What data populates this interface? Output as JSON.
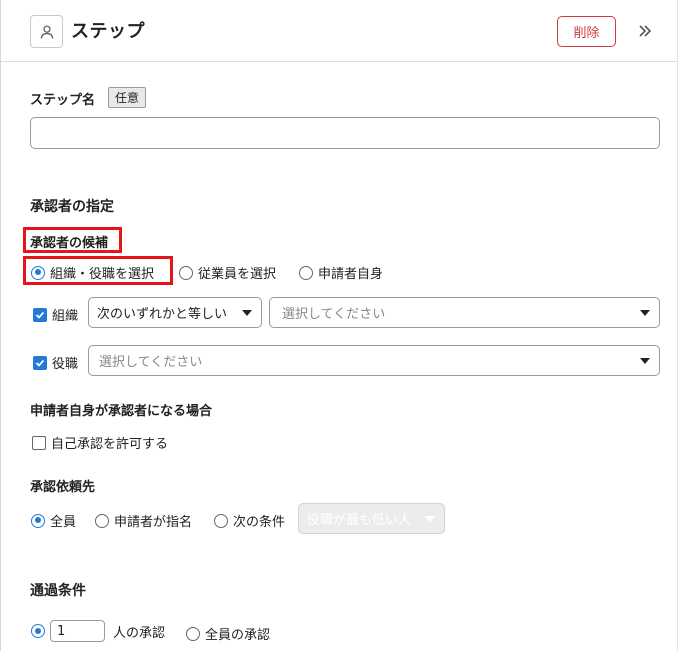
{
  "header": {
    "title": "ステップ",
    "delete_label": "削除",
    "icon": "user-icon",
    "collapse_icon": "double-chevron-right-icon"
  },
  "step_name": {
    "label": "ステップ名",
    "badge": "任意",
    "value": ""
  },
  "approver": {
    "section_title": "承認者の指定",
    "candidates_label": "承認者の候補",
    "candidate_options": [
      {
        "label": "組織・役職を選択",
        "selected": true
      },
      {
        "label": "従業員を選択",
        "selected": false
      },
      {
        "label": "申請者自身",
        "selected": false
      }
    ],
    "org": {
      "label": "組織",
      "checked": true,
      "operator": "次のいずれかと等しい",
      "placeholder": "選択してください"
    },
    "position": {
      "label": "役職",
      "checked": true,
      "placeholder": "選択してください"
    }
  },
  "self_approval": {
    "title": "申請者自身が承認者になる場合",
    "checkbox_label": "自己承認を許可する",
    "checked": false
  },
  "request_target": {
    "title": "承認依頼先",
    "options": [
      {
        "label": "全員",
        "selected": true
      },
      {
        "label": "申請者が指名",
        "selected": false
      },
      {
        "label": "次の条件",
        "selected": false
      }
    ],
    "condition_select": "役職が最も低い人"
  },
  "pass_condition": {
    "title": "通過条件",
    "count_value": "1",
    "count_suffix": "人の承認",
    "all_label": "全員の承認"
  },
  "colors": {
    "accent": "#1f7bd6",
    "danger": "#d0393e",
    "highlight": "#e8141b"
  }
}
